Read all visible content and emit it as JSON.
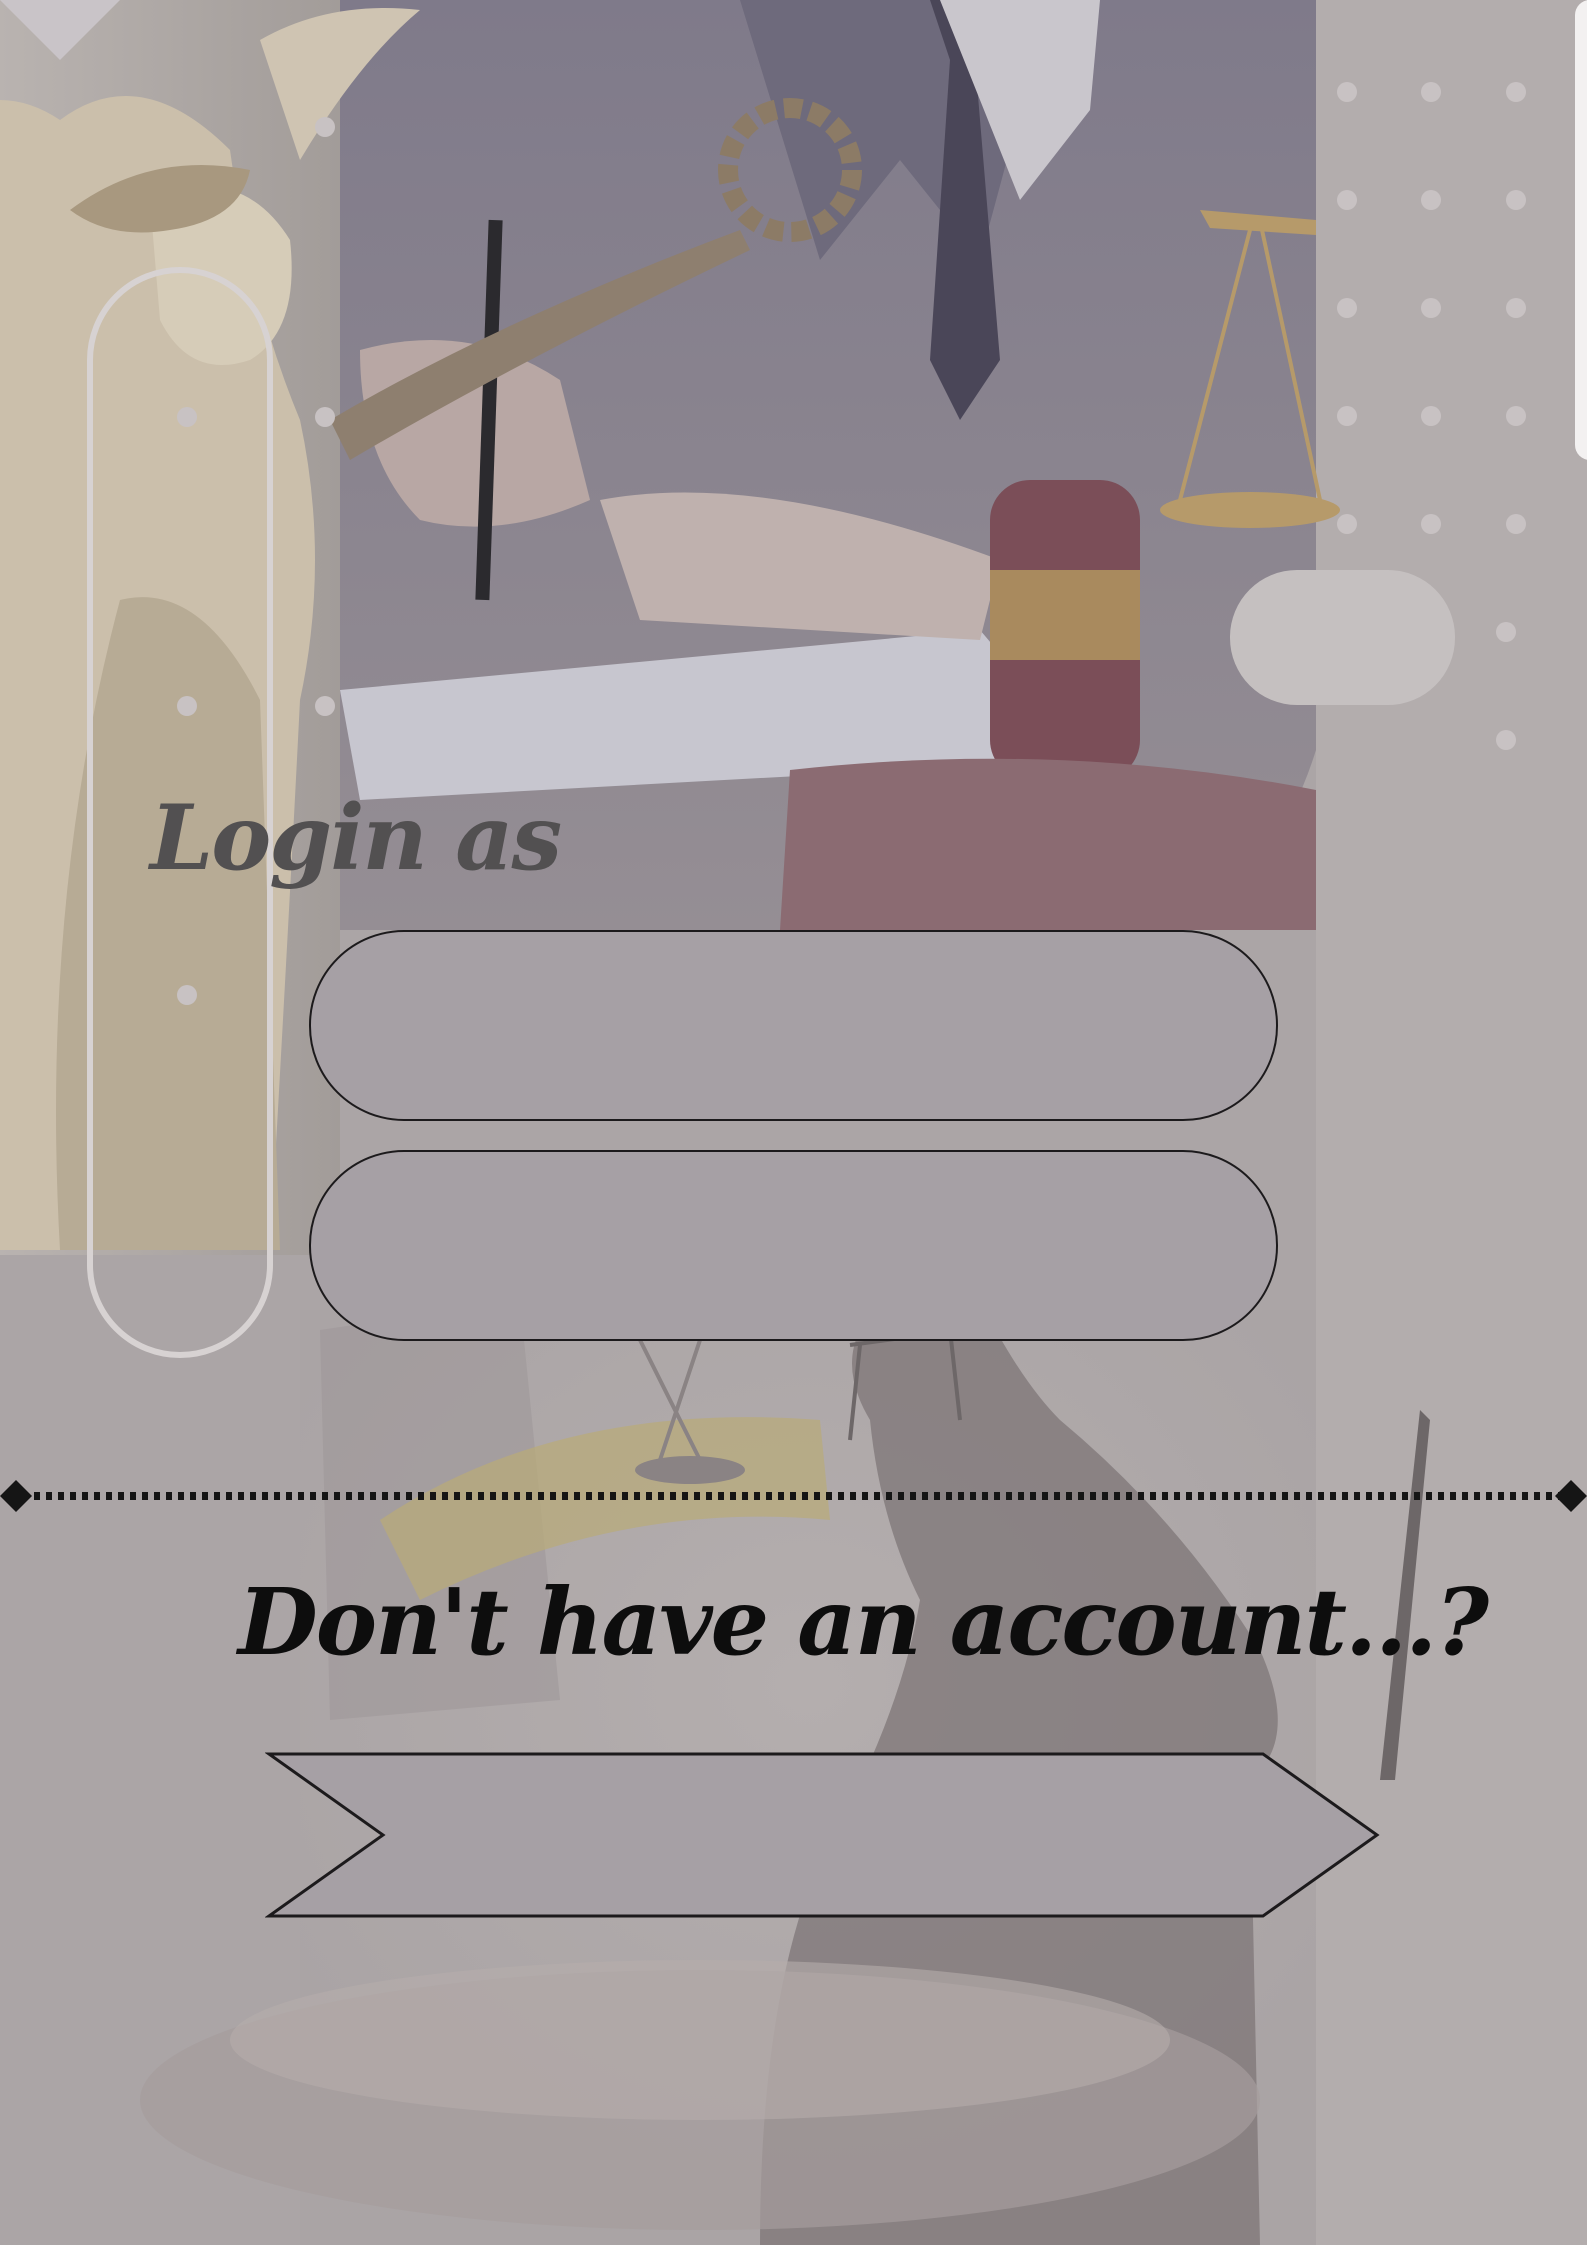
{
  "login": {
    "heading": "Login as",
    "option_1": "",
    "option_2": ""
  },
  "signup": {
    "heading": "Don't have an account...?",
    "button_label": ""
  },
  "icons": [
    "winged-victory-statue",
    "scales-of-justice",
    "gavel",
    "lady-justice-silhouette"
  ],
  "colors": {
    "background": "#aba5a6",
    "button_fill": "#a6a0a5",
    "button_border": "#1c1a1c",
    "login_heading": "#525051",
    "signup_heading": "#0d0d0d"
  }
}
